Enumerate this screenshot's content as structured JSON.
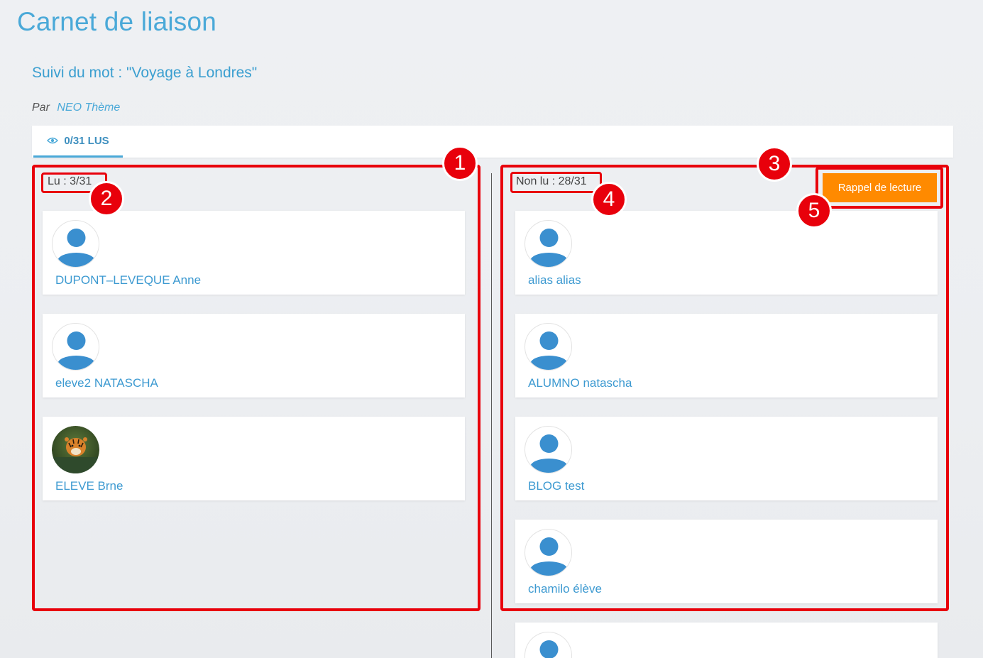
{
  "page": {
    "title": "Carnet de liaison",
    "subtitle": "Suivi du mot : \"Voyage à Londres\"",
    "author_prefix": "Par",
    "author_name": "NEO Thème"
  },
  "tab": {
    "label": "0/31 LUS",
    "icon": "eye-icon"
  },
  "read_column": {
    "count_label": "Lu : 3/31",
    "students": [
      {
        "name": "DUPONT–LEVEQUE Anne",
        "avatar": "default-user"
      },
      {
        "name": "eleve2 NATASCHA",
        "avatar": "default-user"
      },
      {
        "name": "ELEVE Brne",
        "avatar": "tiger-photo"
      }
    ]
  },
  "unread_column": {
    "count_label": "Non lu : 28/31",
    "reminder_button": "Rappel de lecture",
    "students": [
      {
        "name": "alias alias",
        "avatar": "default-user"
      },
      {
        "name": "ALUMNO natascha",
        "avatar": "default-user"
      },
      {
        "name": "BLOG test",
        "avatar": "default-user"
      },
      {
        "name": "chamilo élève",
        "avatar": "default-user"
      },
      {
        "name": "",
        "avatar": "default-user"
      }
    ]
  },
  "annotations": [
    "1",
    "2",
    "3",
    "4",
    "5"
  ],
  "colors": {
    "accent": "#4aa9d8",
    "button": "#ff8a00",
    "annotation": "#e8000b"
  }
}
